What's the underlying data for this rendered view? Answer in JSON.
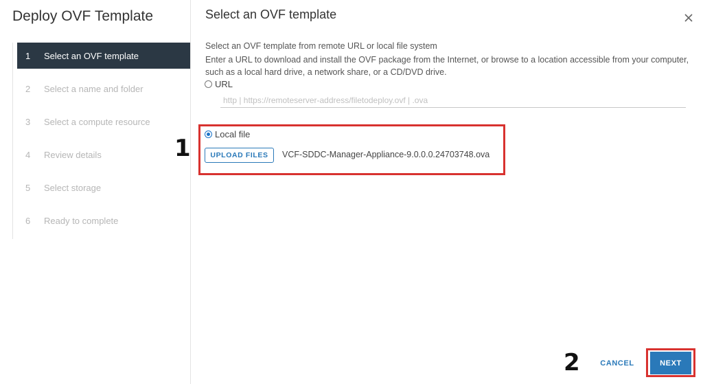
{
  "sidebar": {
    "title": "Deploy OVF Template",
    "steps": [
      {
        "num": "1",
        "label": "Select an OVF template",
        "active": true
      },
      {
        "num": "2",
        "label": "Select a name and folder",
        "active": false
      },
      {
        "num": "3",
        "label": "Select a compute resource",
        "active": false
      },
      {
        "num": "4",
        "label": "Review details",
        "active": false
      },
      {
        "num": "5",
        "label": "Select storage",
        "active": false
      },
      {
        "num": "6",
        "label": "Ready to complete",
        "active": false
      }
    ]
  },
  "main": {
    "title": "Select an OVF template",
    "description_line1": "Select an OVF template from remote URL or local file system",
    "description_line2": "Enter a URL to download and install the OVF package from the Internet, or browse to a location accessible from your computer, such as a local hard drive, a network share, or a CD/DVD drive.",
    "url_option_label": "URL",
    "url_placeholder": "http | https://remoteserver-address/filetodeploy.ovf | .ova",
    "url_value": "",
    "local_file_option_label": "Local file",
    "selected_source": "Local file",
    "upload_button_label": "UPLOAD FILES",
    "selected_file": "VCF-SDDC-Manager-Appliance-9.0.0.0.24703748.ova"
  },
  "footer": {
    "cancel_label": "CANCEL",
    "next_label": "NEXT"
  },
  "annotations": {
    "step1_label": "1",
    "step2_label": "2",
    "highlight_color": "#d8322f"
  },
  "colors": {
    "accent": "#2a79b9",
    "active_step_bg": "#2b3844"
  },
  "icons": {
    "close": "close-icon"
  }
}
